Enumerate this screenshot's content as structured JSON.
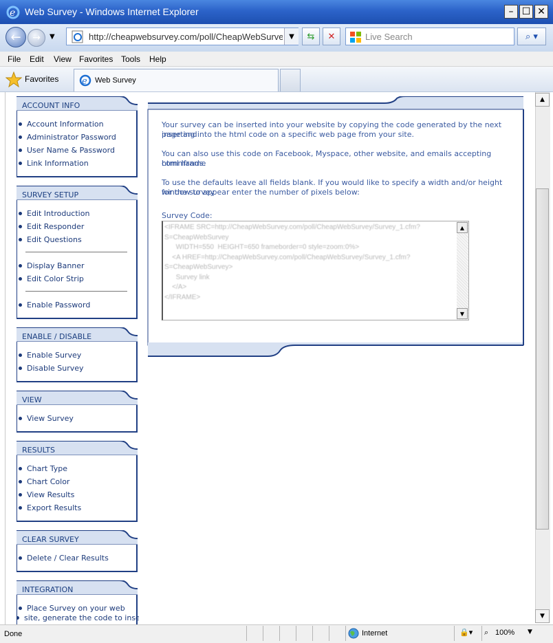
{
  "window": {
    "title": "Web Survey - Windows Internet Explorer"
  },
  "browser": {
    "address": "http://cheapwebsurvey.com/poll/CheapWebSurvey/",
    "search_placeholder": "Live Search",
    "menu": [
      "File",
      "Edit",
      "View",
      "Favorites",
      "Tools",
      "Help"
    ],
    "favorites_label": "Favorites",
    "tab_title": "Web Survey"
  },
  "sidebar": {
    "account": {
      "title": "ACCOUNT INFO",
      "items": [
        "Account Information",
        "Administrator Password",
        "User Name & Password",
        "Link Information"
      ]
    },
    "setup": {
      "title": "SURVEY SETUP",
      "items": [
        "Edit Introduction",
        "Edit Responder",
        "Edit Questions",
        "Display Banner",
        "Edit Color Strip",
        "Enable Password"
      ]
    },
    "enable": {
      "title": "ENABLE / DISABLE",
      "items": [
        "Enable Survey",
        "Disable Survey"
      ]
    },
    "view": {
      "title": "VIEW",
      "items": [
        "View Survey"
      ]
    },
    "results": {
      "title": "RESULTS",
      "items": [
        "Chart Type",
        "Chart Color",
        "View Results",
        "Export Results"
      ]
    },
    "clear": {
      "title": "CLEAR SURVEY",
      "items": [
        "Delete / Clear Results"
      ]
    },
    "integration": {
      "title": "INTEGRATION",
      "items": [
        "Place Survey on your web",
        "site, generate the code to insert"
      ]
    }
  },
  "main": {
    "para1a": "Your survey can be inserted into your website by copying the code generated by the next page and",
    "para1b": "inserting into the html code on a specific web page from your site.",
    "para2a": "You can also use this code on Facebook, Myspace, other website, and emails accepting html Iframe",
    "para2b": "commands.",
    "para3a": "To use the defaults leave all fields blank. If you would like to specify a width and/or height for the survey",
    "para3b": "window to appear enter the number of pixels below:",
    "code_label": "Survey Code:",
    "code": "<IFRAME SRC=http://CheapWebSurvey.com/poll/CheapWebSurvey/Survey_1.cfm?\nS=CheapWebSurvey\n      WIDTH=550  HEIGHT=650 frameborder=0 style=zoom:0%>\n    <A HREF=http://CheapWebSurvey.com/poll/CheapWebSurvey/Survey_1.cfm?\nS=CheapWebSurvey>\n      Survey link\n    </A>\n</IFRAME>"
  },
  "status": {
    "text": "Done",
    "zone": "Internet",
    "zoom": "100%"
  }
}
